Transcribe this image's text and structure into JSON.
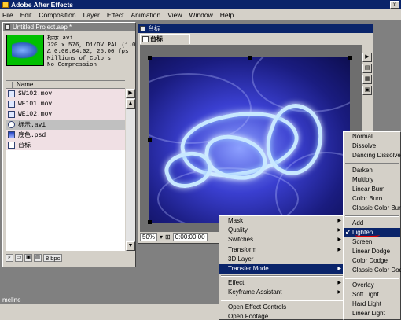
{
  "app": {
    "title": "Adobe After Effects",
    "close": "x"
  },
  "menubar": [
    "File",
    "Edit",
    "Composition",
    "Layer",
    "Effect",
    "Animation",
    "View",
    "Window",
    "Help"
  ],
  "project": {
    "title": "Untitled Project.aep *",
    "selected_name": "标示.avi",
    "info": [
      "720 x 576, D1/DV PAL (1.07",
      "Δ 0:00:04:02, 25.00 fps",
      "Millions of Colors",
      "No Compression"
    ],
    "column_name": "Name",
    "items": [
      {
        "name": "SW102.mov"
      },
      {
        "name": "WE101.mov"
      },
      {
        "name": "WE102.mov"
      },
      {
        "name": "标示.avi"
      },
      {
        "name": "底色.psd"
      },
      {
        "name": "台标"
      }
    ],
    "bpc": "8 bpc"
  },
  "comp": {
    "title": "台标",
    "tab": "台标",
    "zoom": "50%",
    "time": "0:00:00:00"
  },
  "timeline": {
    "title": "meline"
  },
  "context_menu": {
    "items": [
      "Mask",
      "Quality",
      "Switches",
      "Transform",
      "3D Layer",
      "Transfer Mode",
      "Effect",
      "Keyframe Assistant",
      "Open Effect Controls",
      "Open Footage"
    ],
    "highlighted": "Transfer Mode"
  },
  "transfer_submenu": {
    "items": [
      "Normal",
      "Dissolve",
      "Dancing Dissolve",
      "Darken",
      "Multiply",
      "Linear Burn",
      "Color Burn",
      "Classic Color Burn",
      "Add",
      "Lighten",
      "Screen",
      "Linear Dodge",
      "Color Dodge",
      "Classic Color Dodge",
      "Overlay",
      "Soft Light",
      "Hard Light",
      "Linear Light"
    ],
    "checked": "Lighten",
    "check_glyph": "✔"
  },
  "colors": {
    "title_active": "#0a246a",
    "menu_bg": "#d4d0c8",
    "thumb_bg": "#00c000",
    "annotation": "#e00000"
  }
}
